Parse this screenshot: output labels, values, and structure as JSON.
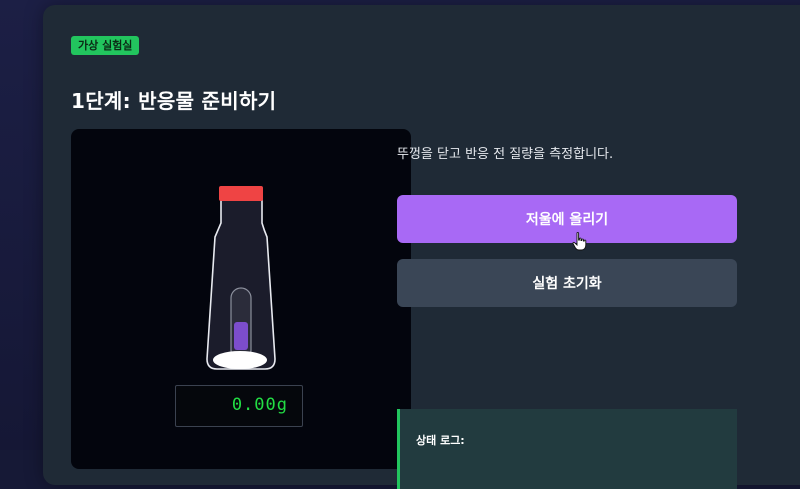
{
  "badge": "가상 실험실",
  "step_title": "1단계: 반응물 준비하기",
  "instruction": "뚜껑을 닫고 반응 전 질량을 측정합니다.",
  "buttons": {
    "place_on_scale": "저울에 올리기",
    "reset": "실험 초기화"
  },
  "scale": {
    "reading": "0.00g"
  },
  "log": {
    "title": "상태 로그:"
  },
  "colors": {
    "badge": "#22c55e",
    "primary_button": "#a869f5",
    "secondary_button": "#3a4656",
    "cap": "#ef4444",
    "liquid": "#7c4dcc",
    "scale_text": "#22dd44"
  },
  "icons": {
    "cursor": "hand-pointer-icon"
  }
}
